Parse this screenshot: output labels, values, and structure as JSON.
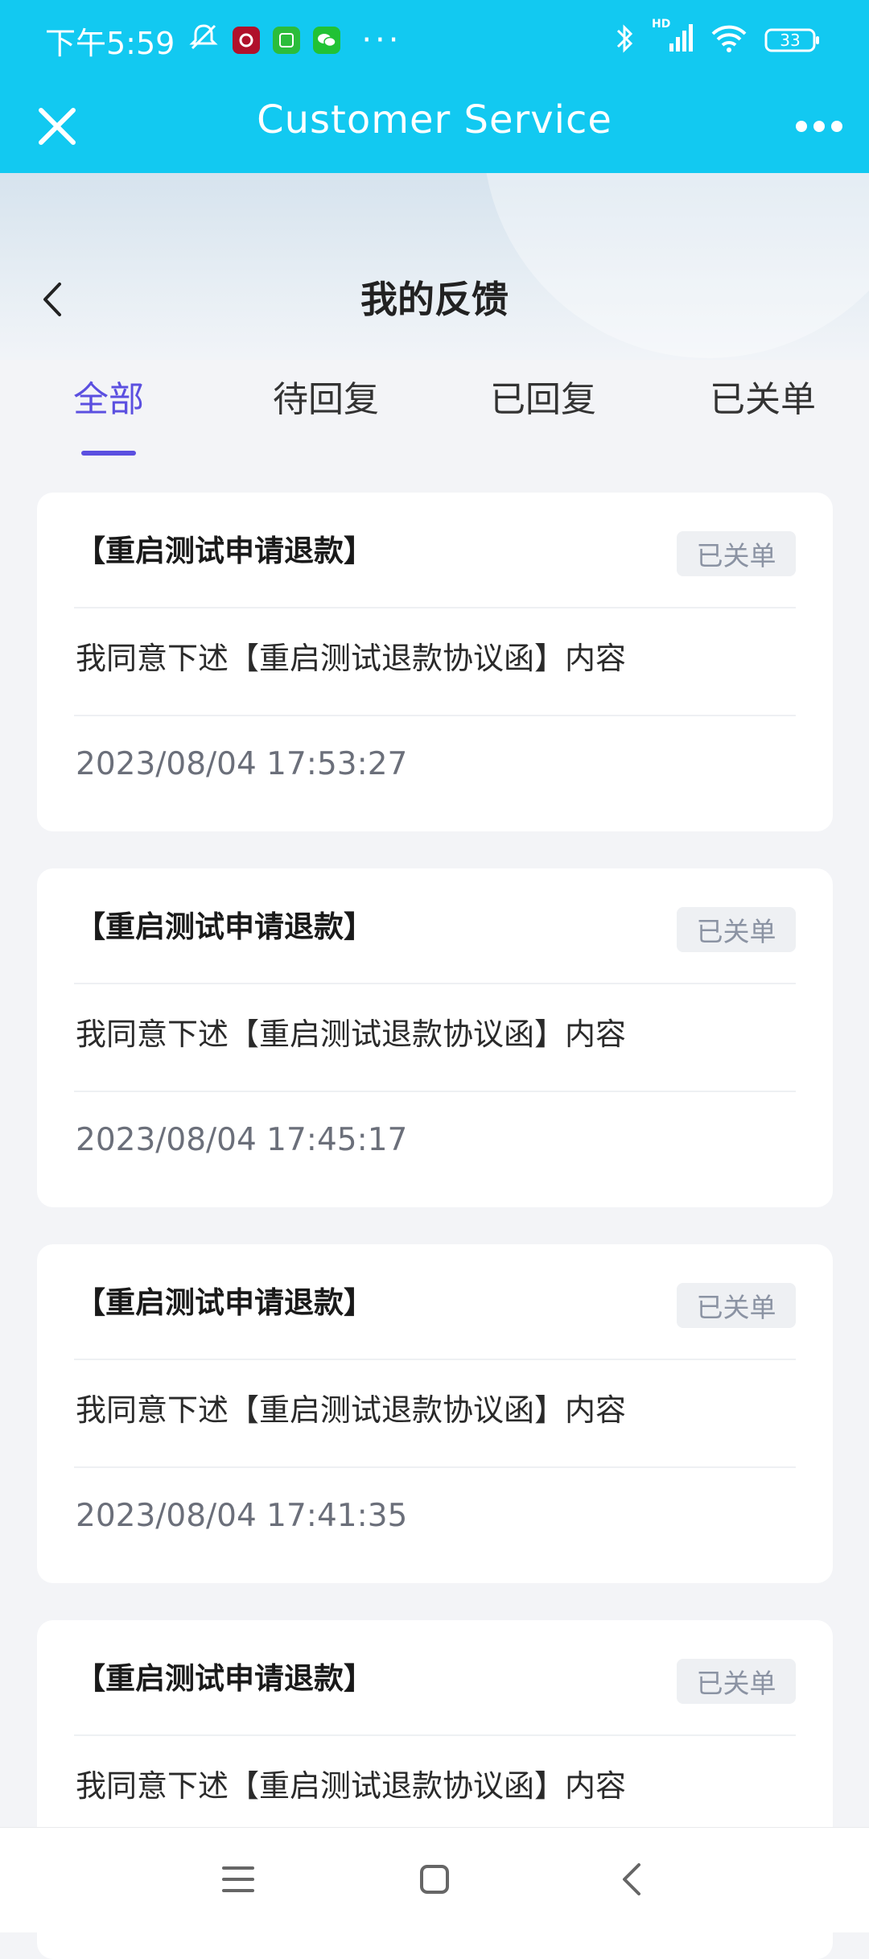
{
  "status_bar": {
    "time": "下午5:59",
    "battery": "33",
    "app_icons": [
      "camera-app-icon",
      "game-app-icon",
      "wechat-icon"
    ],
    "more_indicator": "···",
    "signal_label": "HD"
  },
  "title_bar": {
    "title": "Customer Service"
  },
  "page_header": {
    "title": "我的反馈"
  },
  "tabs": [
    {
      "label": "全部",
      "active": true
    },
    {
      "label": "待回复",
      "active": false
    },
    {
      "label": "已回复",
      "active": false
    },
    {
      "label": "已关单",
      "active": false
    }
  ],
  "cards": [
    {
      "title": "【重启测试申请退款】",
      "status": "已关单",
      "content": "我同意下述【重启测试退款协议函】内容",
      "time": "2023/08/04 17:53:27"
    },
    {
      "title": "【重启测试申请退款】",
      "status": "已关单",
      "content": "我同意下述【重启测试退款协议函】内容",
      "time": "2023/08/04 17:45:17"
    },
    {
      "title": "【重启测试申请退款】",
      "status": "已关单",
      "content": "我同意下述【重启测试退款协议函】内容",
      "time": "2023/08/04 17:41:35"
    },
    {
      "title": "【重启测试申请退款】",
      "status": "已关单",
      "content": "我同意下述【重启测试退款协议函】内容",
      "time": ""
    }
  ],
  "colors": {
    "header_blue": "#12c9f1",
    "accent_purple": "#5b4fe0",
    "badge_bg": "#eef0f3",
    "badge_text": "#8b93a3"
  }
}
